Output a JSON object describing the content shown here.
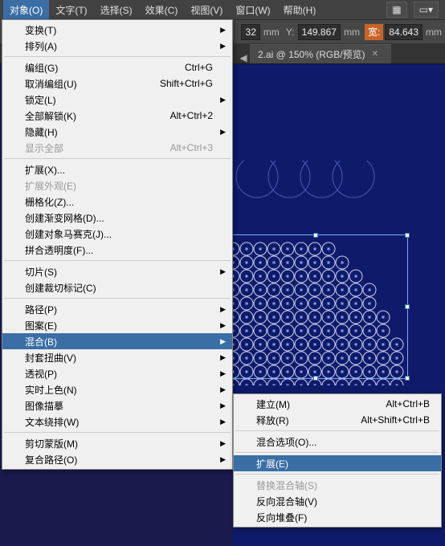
{
  "menubar": {
    "items": [
      {
        "label": "对象(O)",
        "active": true
      },
      {
        "label": "文字(T)"
      },
      {
        "label": "选择(S)"
      },
      {
        "label": "效果(C)"
      },
      {
        "label": "视图(V)"
      },
      {
        "label": "窗口(W)"
      },
      {
        "label": "帮助(H)"
      }
    ]
  },
  "toolbar": {
    "unit": "mm",
    "y_label": "Y:",
    "y_value": "149.867",
    "w_label": "宽:",
    "w_value": "84.643"
  },
  "tabs": {
    "arrow": "◀",
    "current": {
      "label": "2.ai @ 150% (RGB/预览)"
    }
  },
  "menu": {
    "items": [
      {
        "label": "变换(T)",
        "sub": true
      },
      {
        "label": "排列(A)",
        "sub": true
      },
      {
        "sep": true
      },
      {
        "label": "编组(G)",
        "shortcut": "Ctrl+G"
      },
      {
        "label": "取消编组(U)",
        "shortcut": "Shift+Ctrl+G"
      },
      {
        "label": "锁定(L)",
        "sub": true
      },
      {
        "label": "全部解锁(K)",
        "shortcut": "Alt+Ctrl+2"
      },
      {
        "label": "隐藏(H)",
        "sub": true
      },
      {
        "label": "显示全部",
        "shortcut": "Alt+Ctrl+3",
        "disabled": true
      },
      {
        "sep": true
      },
      {
        "label": "扩展(X)..."
      },
      {
        "label": "扩展外观(E)",
        "disabled": true
      },
      {
        "label": "栅格化(Z)..."
      },
      {
        "label": "创建渐变网格(D)..."
      },
      {
        "label": "创建对象马赛克(J)..."
      },
      {
        "label": "拼合透明度(F)..."
      },
      {
        "sep": true
      },
      {
        "label": "切片(S)",
        "sub": true
      },
      {
        "label": "创建裁切标记(C)"
      },
      {
        "sep": true
      },
      {
        "label": "路径(P)",
        "sub": true
      },
      {
        "label": "图案(E)",
        "sub": true
      },
      {
        "label": "混合(B)",
        "sub": true,
        "highlight": true
      },
      {
        "label": "封套扭曲(V)",
        "sub": true
      },
      {
        "label": "透视(P)",
        "sub": true
      },
      {
        "label": "实时上色(N)",
        "sub": true
      },
      {
        "label": "图像描摹",
        "sub": true
      },
      {
        "label": "文本绕排(W)",
        "sub": true
      },
      {
        "sep": true
      },
      {
        "label": "剪切蒙版(M)",
        "sub": true
      },
      {
        "label": "复合路径(O)",
        "sub": true
      }
    ]
  },
  "submenu": {
    "items": [
      {
        "label": "建立(M)",
        "shortcut": "Alt+Ctrl+B"
      },
      {
        "label": "释放(R)",
        "shortcut": "Alt+Shift+Ctrl+B"
      },
      {
        "sep": true
      },
      {
        "label": "混合选项(O)..."
      },
      {
        "sep": true
      },
      {
        "label": "扩展(E)",
        "highlight": true
      },
      {
        "sep": true
      },
      {
        "label": "替换混合轴(S)",
        "disabled": true
      },
      {
        "label": "反向混合轴(V)"
      },
      {
        "label": "反向堆叠(F)"
      }
    ]
  }
}
